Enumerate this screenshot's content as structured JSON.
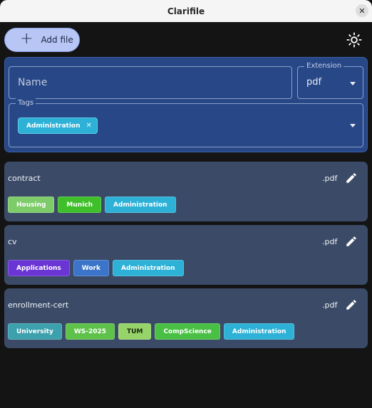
{
  "window": {
    "title": "Clarifile",
    "close_glyph": "✕"
  },
  "toolbar": {
    "add_label": "Add file",
    "add_icon": "plus-icon",
    "theme_icon": "sun-icon"
  },
  "filter": {
    "name_placeholder": "Name",
    "extension_label": "Extension",
    "extension_value": "pdf",
    "tags_label": "Tags",
    "selected_tags": [
      {
        "label": "Administration",
        "remove": "✕",
        "color": "#2db1d6"
      }
    ]
  },
  "colors": {
    "background": "#141414",
    "panel": "#274786",
    "card": "#3b4b67",
    "accent_button": "#b7c6f4"
  },
  "files": [
    {
      "name": "contract",
      "extension": ".pdf",
      "tags": [
        {
          "label": "Housing",
          "color": "#7ecb6a"
        },
        {
          "label": "Munich",
          "color": "#3fbf2a"
        },
        {
          "label": "Administration",
          "color": "#2db1d6"
        }
      ]
    },
    {
      "name": "cv",
      "extension": ".pdf",
      "tags": [
        {
          "label": "Applications",
          "color": "#6a35d4"
        },
        {
          "label": "Work",
          "color": "#3b74c9"
        },
        {
          "label": "Administration",
          "color": "#2db1d6"
        }
      ]
    },
    {
      "name": "enrollment-cert",
      "extension": ".pdf",
      "tags": [
        {
          "label": "University",
          "color": "#3da0ad"
        },
        {
          "label": "WS-2025",
          "color": "#5ec24a"
        },
        {
          "label": "TUM",
          "color": "#96d46a",
          "dark": true
        },
        {
          "label": "CompScience",
          "color": "#49c044"
        },
        {
          "label": "Administration",
          "color": "#2db1d6"
        }
      ]
    }
  ]
}
